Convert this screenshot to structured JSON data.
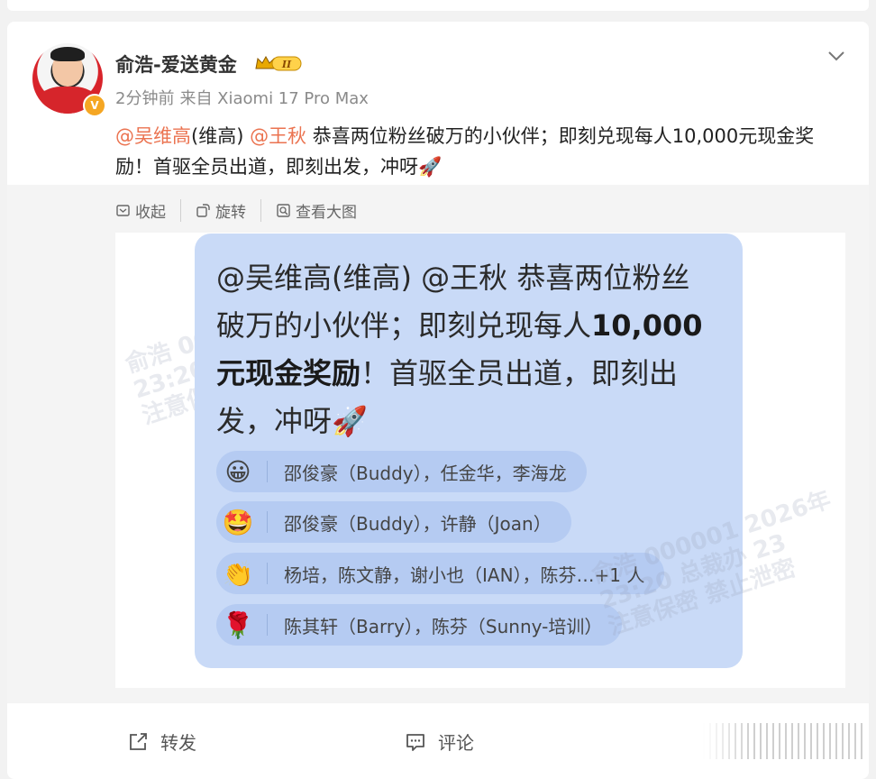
{
  "post": {
    "username": "俞浩-爱送黄金",
    "level_badge": "II",
    "time": "2分钟前",
    "source": "来自 Xiaomi 17 Pro Max",
    "mention1": "@吴维高",
    "mention1_suffix": "(维高) ",
    "mention2": "@王秋",
    "body": " 恭喜两位粉丝破万的小伙伴；即刻兑现每人10,000元现金奖励！首驱全员出道，即刻出发，冲呀🚀"
  },
  "toolbar": {
    "collapse": "收起",
    "rotate": "旋转",
    "view_large": "查看大图"
  },
  "image": {
    "line1": "@吴维高(维高) @王秋 恭喜两位粉丝",
    "line2_a": "破万的小伙伴；即刻兑现每人",
    "line2_b": "10,000",
    "line3_a": "元现金奖励",
    "line3_b": "！首驱全员出道，即刻出",
    "line4": "发，冲呀🚀",
    "reactions": [
      {
        "emoji": "😀",
        "names": "邵俊豪（Buddy），任金华，李海龙"
      },
      {
        "emoji": "🤩",
        "names": "邵俊豪（Buddy），许静（Joan）"
      },
      {
        "emoji": "👏",
        "names": "杨培，陈文静，谢小也（IAN），陈芬…+1 人"
      },
      {
        "emoji": "🌹",
        "names": "陈其轩（Barry），陈芬（Sunny-培训）"
      }
    ],
    "watermark1": "俞浩 000001 2026年1月30日\n23:20 总裁办 严禁泄密\n注意保密",
    "watermark2": "俞浩 000001 2026年\n23:20 总裁办 23\n注意保密 禁止泄密"
  },
  "actions": {
    "repost": "转发",
    "comment": "评论"
  },
  "colors": {
    "mention": "#eb7350",
    "bubble": "#c9daf7",
    "reaction_pill": "#b5cbf2"
  }
}
